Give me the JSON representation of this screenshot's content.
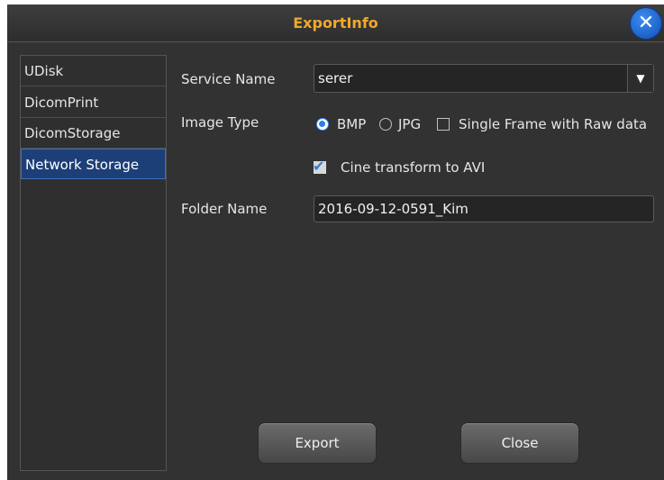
{
  "dialog": {
    "title": "ExportInfo",
    "close_icon": "close-icon",
    "close_glyph": "✕"
  },
  "sidebar": {
    "items": [
      {
        "label": "UDisk",
        "active": false
      },
      {
        "label": "DicomPrint",
        "active": false
      },
      {
        "label": "DicomStorage",
        "active": false
      },
      {
        "label": "Network Storage",
        "active": true
      }
    ]
  },
  "form": {
    "service_name_label": "Service Name",
    "service_name_value": "serer",
    "dropdown_glyph": "▼",
    "image_type_label": "Image Type",
    "image_type_options": [
      {
        "label": "BMP",
        "selected": true
      },
      {
        "label": "JPG",
        "selected": false
      }
    ],
    "single_frame_label": "Single Frame with Raw data",
    "single_frame_checked": false,
    "cine_label": "Cine transform to AVI",
    "cine_checked": true,
    "check_glyph": "✔",
    "folder_name_label": "Folder Name",
    "folder_name_value": "2016-09-12-0591_Kim"
  },
  "buttons": {
    "export_label": "Export",
    "close_label": "Close"
  },
  "colors": {
    "title": "#f0a92c",
    "accent": "#2f7de1",
    "selected_nav": "#1d3f78",
    "panel": "#323232"
  }
}
